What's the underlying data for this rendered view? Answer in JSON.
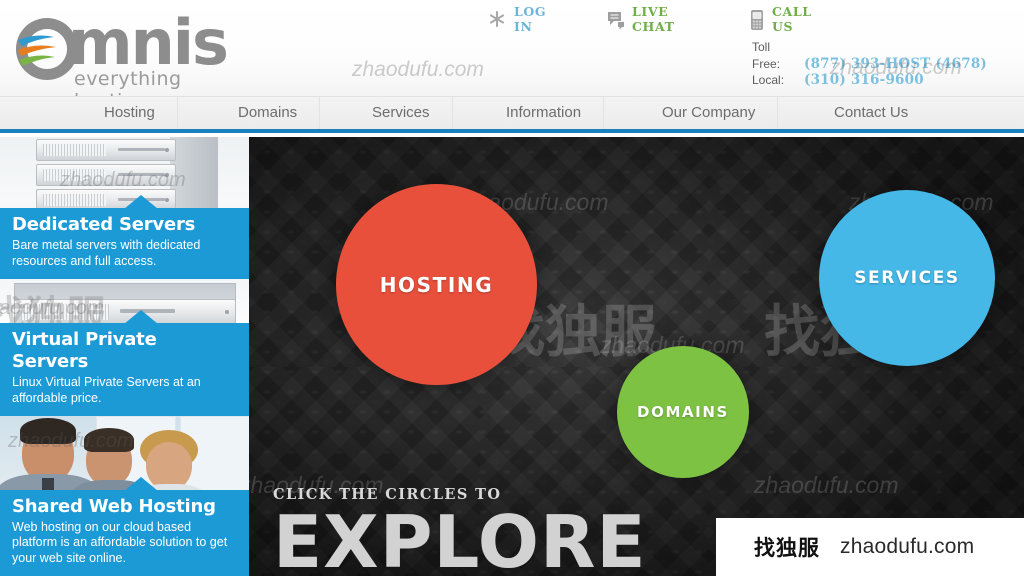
{
  "site": {
    "logo_word": "mnis",
    "logo_tagline": "everything hosting",
    "logo_mark_icon": "omnis-swoosh-logo"
  },
  "header": {
    "links": [
      {
        "label": "LOG IN",
        "icon": "asterisk-icon",
        "color": "#6cb4d8"
      },
      {
        "label": "LIVE CHAT",
        "icon": "chat-bubble-icon",
        "color": "#6fae49"
      },
      {
        "label": "CALL US",
        "icon": "mobile-phone-icon",
        "color": "#6fae49"
      }
    ],
    "phone": {
      "toll_line1": "Toll",
      "toll_line2": "Free:",
      "toll_number": "(877) 393-HOST (4678)",
      "local_label": "Local:",
      "local_number": "(310) 316-9600"
    }
  },
  "nav": {
    "accent_color": "#1b80bd",
    "items": [
      {
        "label": "Hosting"
      },
      {
        "label": "Domains"
      },
      {
        "label": "Services"
      },
      {
        "label": "Information"
      },
      {
        "label": "Our Company"
      },
      {
        "label": "Contact Us"
      }
    ]
  },
  "sidebar": {
    "panels": [
      {
        "title": "Dedicated Servers",
        "desc": "Bare metal servers with dedicated resources and full access.",
        "image": "stacked-rack-servers-photo"
      },
      {
        "title": "Virtual Private Servers",
        "desc": "Linux Virtual Private Servers at an affordable price.",
        "image": "single-rack-server-photo"
      },
      {
        "title": "Shared Web Hosting",
        "desc": "Web hosting on our cloud based platform is an affordable solution to get your web site online.",
        "image": "business-team-photo"
      }
    ]
  },
  "hero": {
    "background": "#242424",
    "circles": [
      {
        "label": "HOSTING",
        "color": "#e8503c"
      },
      {
        "label": "SERVICES",
        "color": "#45b8e8"
      },
      {
        "label": "DOMAINS",
        "color": "#7dc242"
      }
    ],
    "cta_small": "CLICK THE CIRCLES TO",
    "cta_big": "EXPLORE"
  },
  "watermarks": {
    "domain": "zhaodufu.com",
    "cn": "找独服",
    "badge_cn": "找独服",
    "badge_url": "zhaodufu.com"
  }
}
